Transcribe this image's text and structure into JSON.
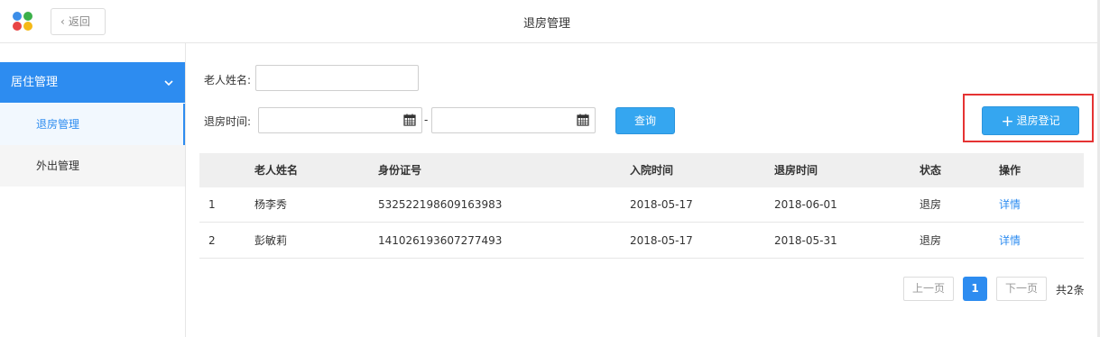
{
  "header": {
    "back_label": "返回",
    "title": "退房管理"
  },
  "sidebar": {
    "group_label": "居住管理",
    "items": [
      {
        "label": "退房管理"
      },
      {
        "label": "外出管理"
      }
    ]
  },
  "filters": {
    "name_label": "老人姓名:",
    "name_value": "",
    "date_label": "退房时间:",
    "date_from": "",
    "date_to": "",
    "date_separator": "-",
    "query_label": "查询"
  },
  "add_button": {
    "label": "退房登记",
    "icon": "plus-icon"
  },
  "table": {
    "columns": [
      "",
      "老人姓名",
      "身份证号",
      "入院时间",
      "退房时间",
      "状态",
      "操作"
    ],
    "rows": [
      [
        "1",
        "杨李秀",
        "532522198609163983",
        "2018-05-17",
        "2018-06-01",
        "退房",
        "详情"
      ],
      [
        "2",
        "彭敏莉",
        "141026193607277493",
        "2018-05-17",
        "2018-05-31",
        "退房",
        "详情"
      ]
    ]
  },
  "pagination": {
    "prev": "上一页",
    "current": "1",
    "next": "下一页",
    "total": "共2条"
  },
  "colors": {
    "accent": "#2d8cf0",
    "button": "#35a6f0",
    "highlight_border": "#e53333"
  }
}
